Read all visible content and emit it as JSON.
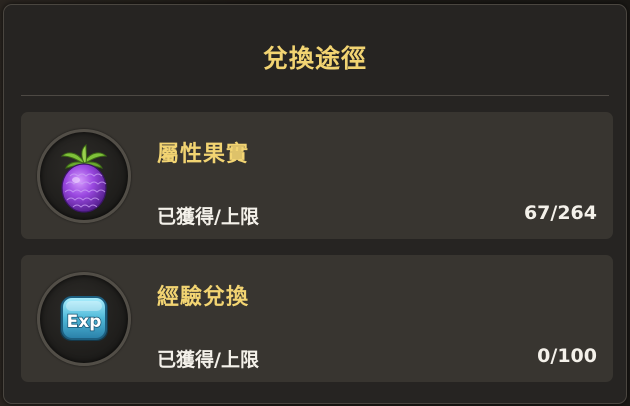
{
  "dialog": {
    "title": "兌換途徑"
  },
  "sources": [
    {
      "name": "屬性果實",
      "icon": "purple-fruit-icon",
      "obtained_label": "已獲得/上限",
      "obtained_value": "67/264"
    },
    {
      "name": "經驗兌換",
      "icon": "exp-icon",
      "obtained_label": "已獲得/上限",
      "obtained_value": "0/100"
    }
  ],
  "colors": {
    "title": "#f2d472",
    "text": "#f4f1ea",
    "panel": "#262422",
    "card": "#383530",
    "fruit": "#8a3fd0",
    "exp_badge": "#5ec6e0"
  }
}
